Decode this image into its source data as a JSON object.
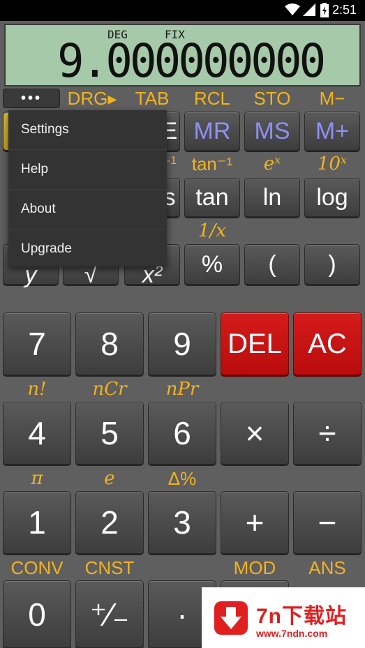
{
  "status": {
    "time": "2:51",
    "icons": [
      "wifi-icon",
      "signal-icon",
      "battery-icon"
    ]
  },
  "display": {
    "angle_mode": "DEG",
    "format_mode": "FIX",
    "value": "9.000000000"
  },
  "menu": {
    "more_label": "•••",
    "items": [
      "Settings",
      "Help",
      "About",
      "Upgrade"
    ]
  },
  "shift_labels": {
    "drg": "DRG▸",
    "tab": "TAB",
    "rcl": "RCL",
    "sto": "STO",
    "m_minus": "M−",
    "tan_inv": "tan⁻¹",
    "ex": "eˣ",
    "tenx": "10ˣ",
    "inv": "1/x",
    "fact": "n!",
    "ncr": "nCr",
    "npr": "nPr",
    "pi": "π",
    "e": "e",
    "delta": "Δ%",
    "conv": "CONV",
    "cnst": "CNST",
    "mod": "MOD",
    "ans": "ANS",
    "partial_ee": "E",
    "partial_sup": "-1",
    "partial_s": "s"
  },
  "keys": {
    "mr": "MR",
    "ms": "MS",
    "mplus": "M+",
    "tan": "tan",
    "ln": "ln",
    "log": "log",
    "percent": "%",
    "lparen": "(",
    "rparen": ")",
    "partial_y": "y",
    "partial_sqrt": "√",
    "partial_x2": "x²",
    "seven": "7",
    "eight": "8",
    "nine": "9",
    "del": "DEL",
    "ac": "AC",
    "four": "4",
    "five": "5",
    "six": "6",
    "mul": "×",
    "div": "÷",
    "one": "1",
    "two": "2",
    "three": "3",
    "plus": "+",
    "minus": "−",
    "zero": "0",
    "sign": "⁺⁄₋",
    "dot": "·"
  },
  "watermark": {
    "title": "7n下载站",
    "url": "www.7ndn.com"
  },
  "colors": {
    "lcd": "#a6c9a9",
    "shift": "#f2b320",
    "memory": "#8f8ff5",
    "red_key": "#c81212"
  }
}
